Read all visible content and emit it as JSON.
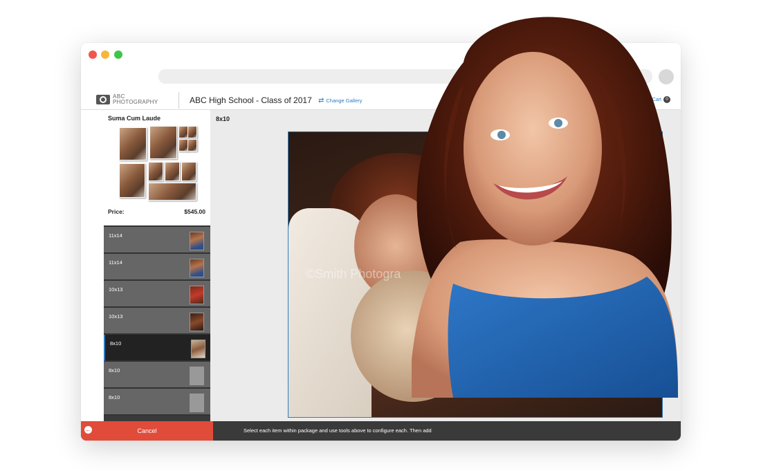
{
  "app": {
    "brand_line1": "ABC",
    "brand_line2": "PHOTOGRAPHY",
    "gallery_title": "ABC High School - Class of 2017",
    "change_gallery_label": "Change Gallery",
    "cart_label": "Cart",
    "cart_count": "0"
  },
  "package": {
    "name": "Suma Cum Laude",
    "price_label": "Price:",
    "price_value": "$545.00"
  },
  "items": [
    {
      "label": "11x14"
    },
    {
      "label": "11x14"
    },
    {
      "label": "10x13"
    },
    {
      "label": "10x13"
    },
    {
      "label": "8x10"
    },
    {
      "label": "8x10"
    },
    {
      "label": "8x10"
    }
  ],
  "selected_item_index": 4,
  "canvas": {
    "size_label": "8x10",
    "watermark": "©Smith Photogra"
  },
  "footer": {
    "cancel_label": "Cancel",
    "instructions": "Select each item within package and use tools above to configure each. Then add"
  },
  "colors": {
    "accent_blue": "#2e7bbf",
    "cancel_red": "#e14b3a",
    "panel_dark": "#3a3a3a"
  }
}
